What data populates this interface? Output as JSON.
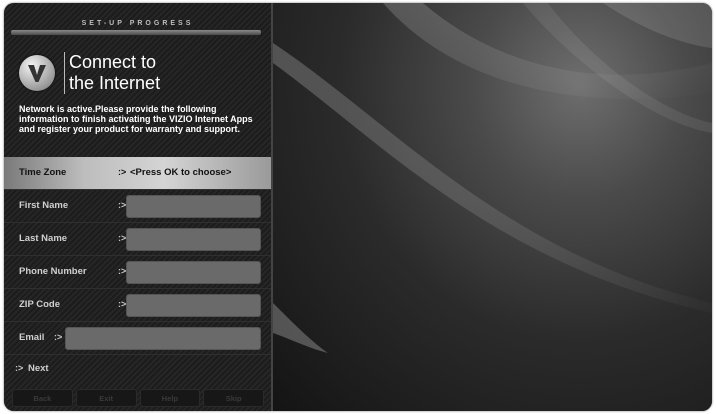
{
  "setup": {
    "progress_label": "SET-UP PROGRESS",
    "title_line1": "Connect to",
    "title_line2": "the Internet",
    "intro": "Network is active.Please provide the following information to finish activating the VIZIO Internet Apps and register your product for warranty and support."
  },
  "form": {
    "time_zone_label": "Time Zone",
    "time_zone_value": "<Press OK to choose>",
    "first_name_label": "First Name",
    "last_name_label": "Last Name",
    "phone_label": "Phone Number",
    "zip_label": "ZIP Code",
    "email_label": "Email",
    "arrow": ":>",
    "next_label": "Next"
  },
  "bottom_buttons": [
    "Back",
    "Exit",
    "Help",
    "Skip"
  ],
  "icons": {
    "logo": "vizio-v-logo-icon"
  },
  "colors": {
    "panel_bg": "#1f1f1f",
    "highlight": "#d4d4d4",
    "field_bg": "#6a6a6a",
    "text": "#ffffff"
  }
}
